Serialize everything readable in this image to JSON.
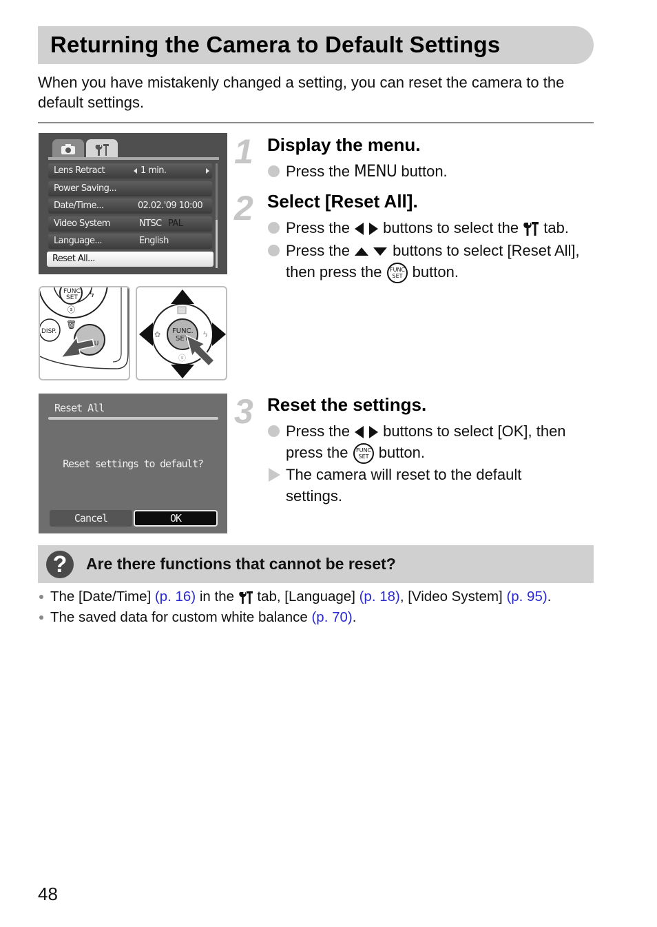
{
  "header": {
    "title": "Returning the Camera to Default Settings",
    "intro": "When you have mistakenly changed a setting, you can reset the camera to the default settings."
  },
  "menu_screen": {
    "tabs": [
      {
        "icon": "camera-icon",
        "active": false
      },
      {
        "icon": "setup-tools-icon",
        "active": true
      }
    ],
    "rows": [
      {
        "label": "Lens Retract",
        "value": "1 min.",
        "has_arrows": true
      },
      {
        "label": "Power Saving...",
        "value": ""
      },
      {
        "label": "Date/Time...",
        "value": "02.02.'09 10:00"
      },
      {
        "label": "Video System",
        "value": "NTSC",
        "value_alt": "PAL"
      },
      {
        "label": "Language...",
        "value": "English"
      },
      {
        "label": "Reset All...",
        "value": "",
        "selected": true
      }
    ]
  },
  "illustrations": {
    "menu_button": {
      "labels": [
        "FUNC.\nSET",
        "DISP.",
        "MENU"
      ]
    },
    "dpad": {
      "center_label": "FUNC.\nSET"
    }
  },
  "reset_dialog": {
    "title": "Reset All",
    "message": "Reset settings to default?",
    "buttons": [
      {
        "label": "Cancel",
        "selected": false
      },
      {
        "label": "OK",
        "selected": true
      }
    ]
  },
  "steps": [
    {
      "number": "1",
      "title": "Display the menu.",
      "bullets": [
        {
          "type": "dot",
          "pre": "Press the ",
          "key": "MENU",
          "post": " button."
        }
      ]
    },
    {
      "number": "2",
      "title": "Select [Reset All].",
      "bullets": [
        {
          "type": "dot",
          "pre": "Press the ",
          "key": "left-right-arrows",
          "mid": " buttons to select the ",
          "key2": "setup-tools",
          "post": " tab."
        },
        {
          "type": "dot",
          "pre": "Press the ",
          "key": "up-down-arrows",
          "mid": " buttons to select [Reset All], then press the ",
          "key2": "FUNC/SET",
          "post": " button."
        }
      ]
    },
    {
      "number": "3",
      "title": "Reset the settings.",
      "bullets": [
        {
          "type": "dot",
          "pre": "Press the ",
          "key": "left-right-arrows",
          "mid": " buttons to select [OK], then press the ",
          "key2": "FUNC/SET",
          "post": " button."
        },
        {
          "type": "result",
          "text": "The camera will reset to the default settings."
        }
      ]
    }
  ],
  "faq": {
    "title": "Are there functions that cannot be reset?",
    "items": [
      {
        "t1": "The [Date/Time] ",
        "l1": "(p. 16)",
        "t2": " in the ",
        "t3": " tab, [Language] ",
        "l2": "(p. 18)",
        "t4": ", [Video System] ",
        "l3": "(p. 95)",
        "t5": "."
      },
      {
        "t1": "The saved data for custom white balance ",
        "l1": "(p. 70)",
        "t2": "."
      }
    ]
  },
  "colors": {
    "title_bar": "#d0d0d0",
    "link": "#2a2ad0",
    "step_number": "#c6c6c6",
    "bullet": "#c8c8c8"
  },
  "page": {
    "number": "48"
  }
}
